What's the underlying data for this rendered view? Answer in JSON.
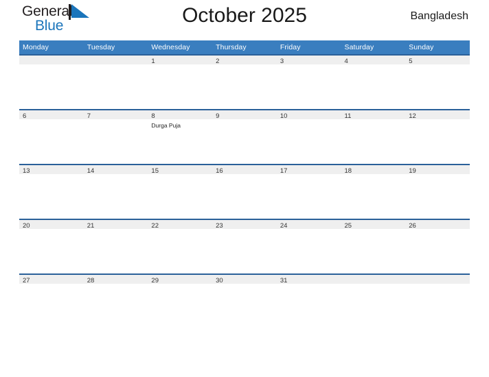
{
  "brand": {
    "name_part1": "General",
    "name_part2": "Blue",
    "flag_icon": "flag-triangle-icon",
    "color_dark": "#231f20",
    "color_blue": "#1b75bb"
  },
  "header": {
    "title": "October 2025",
    "region": "Bangladesh"
  },
  "calendar": {
    "header_bg": "#3a7ebf",
    "band_bg": "#efefef",
    "band_border": "#2a6099",
    "weekdays": [
      "Monday",
      "Tuesday",
      "Wednesday",
      "Thursday",
      "Friday",
      "Saturday",
      "Sunday"
    ],
    "weeks": [
      [
        {
          "day": "",
          "events": []
        },
        {
          "day": "",
          "events": []
        },
        {
          "day": "1",
          "events": []
        },
        {
          "day": "2",
          "events": []
        },
        {
          "day": "3",
          "events": []
        },
        {
          "day": "4",
          "events": []
        },
        {
          "day": "5",
          "events": []
        }
      ],
      [
        {
          "day": "6",
          "events": []
        },
        {
          "day": "7",
          "events": []
        },
        {
          "day": "8",
          "events": [
            "Durga Puja"
          ]
        },
        {
          "day": "9",
          "events": []
        },
        {
          "day": "10",
          "events": []
        },
        {
          "day": "11",
          "events": []
        },
        {
          "day": "12",
          "events": []
        }
      ],
      [
        {
          "day": "13",
          "events": []
        },
        {
          "day": "14",
          "events": []
        },
        {
          "day": "15",
          "events": []
        },
        {
          "day": "16",
          "events": []
        },
        {
          "day": "17",
          "events": []
        },
        {
          "day": "18",
          "events": []
        },
        {
          "day": "19",
          "events": []
        }
      ],
      [
        {
          "day": "20",
          "events": []
        },
        {
          "day": "21",
          "events": []
        },
        {
          "day": "22",
          "events": []
        },
        {
          "day": "23",
          "events": []
        },
        {
          "day": "24",
          "events": []
        },
        {
          "day": "25",
          "events": []
        },
        {
          "day": "26",
          "events": []
        }
      ],
      [
        {
          "day": "27",
          "events": []
        },
        {
          "day": "28",
          "events": []
        },
        {
          "day": "29",
          "events": []
        },
        {
          "day": "30",
          "events": []
        },
        {
          "day": "31",
          "events": []
        },
        {
          "day": "",
          "events": []
        },
        {
          "day": "",
          "events": []
        }
      ]
    ]
  }
}
